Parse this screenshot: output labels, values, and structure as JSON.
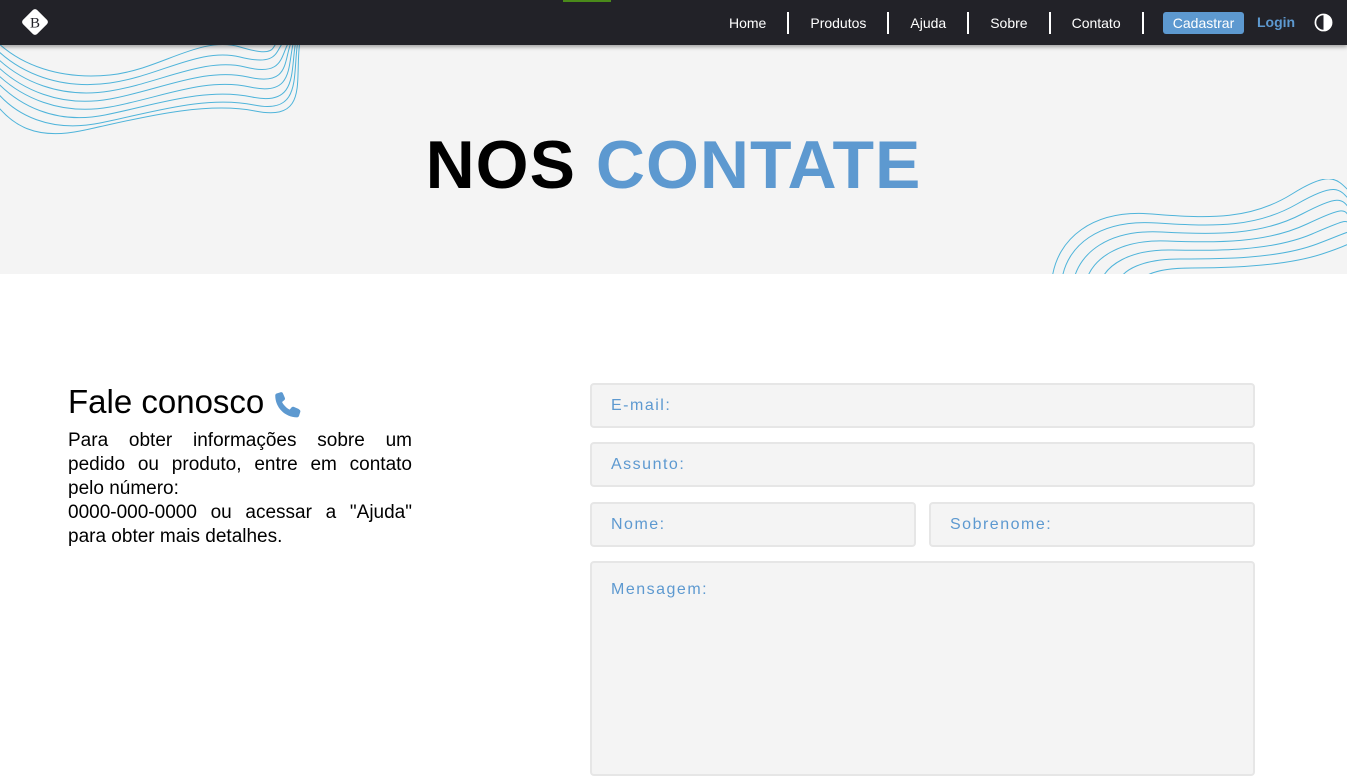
{
  "nav": {
    "links": [
      "Home",
      "Produtos",
      "Ajuda",
      "Sobre",
      "Contato"
    ],
    "cadastrar": "Cadastrar",
    "login": "Login"
  },
  "hero": {
    "title_part1": "NOS",
    "title_part2": "CONTATE"
  },
  "info": {
    "heading": "Fale conosco",
    "paragraph": "Para obter informações sobre um pedido ou produto, entre em contato pelo número:",
    "paragraph2": "0000-000-0000 ou acessar a \"Ajuda\" para obter mais detalhes."
  },
  "form": {
    "email_placeholder": "E-mail:",
    "assunto_placeholder": "Assunto:",
    "nome_placeholder": "Nome:",
    "sobrenome_placeholder": "Sobrenome:",
    "mensagem_placeholder": "Mensagem:"
  },
  "colors": {
    "accent": "#5d99d0",
    "navbar": "#222228",
    "hero_bg": "#f4f4f4"
  },
  "icons": [
    "brand-logo-icon",
    "contrast-toggle-icon",
    "phone-icon"
  ]
}
